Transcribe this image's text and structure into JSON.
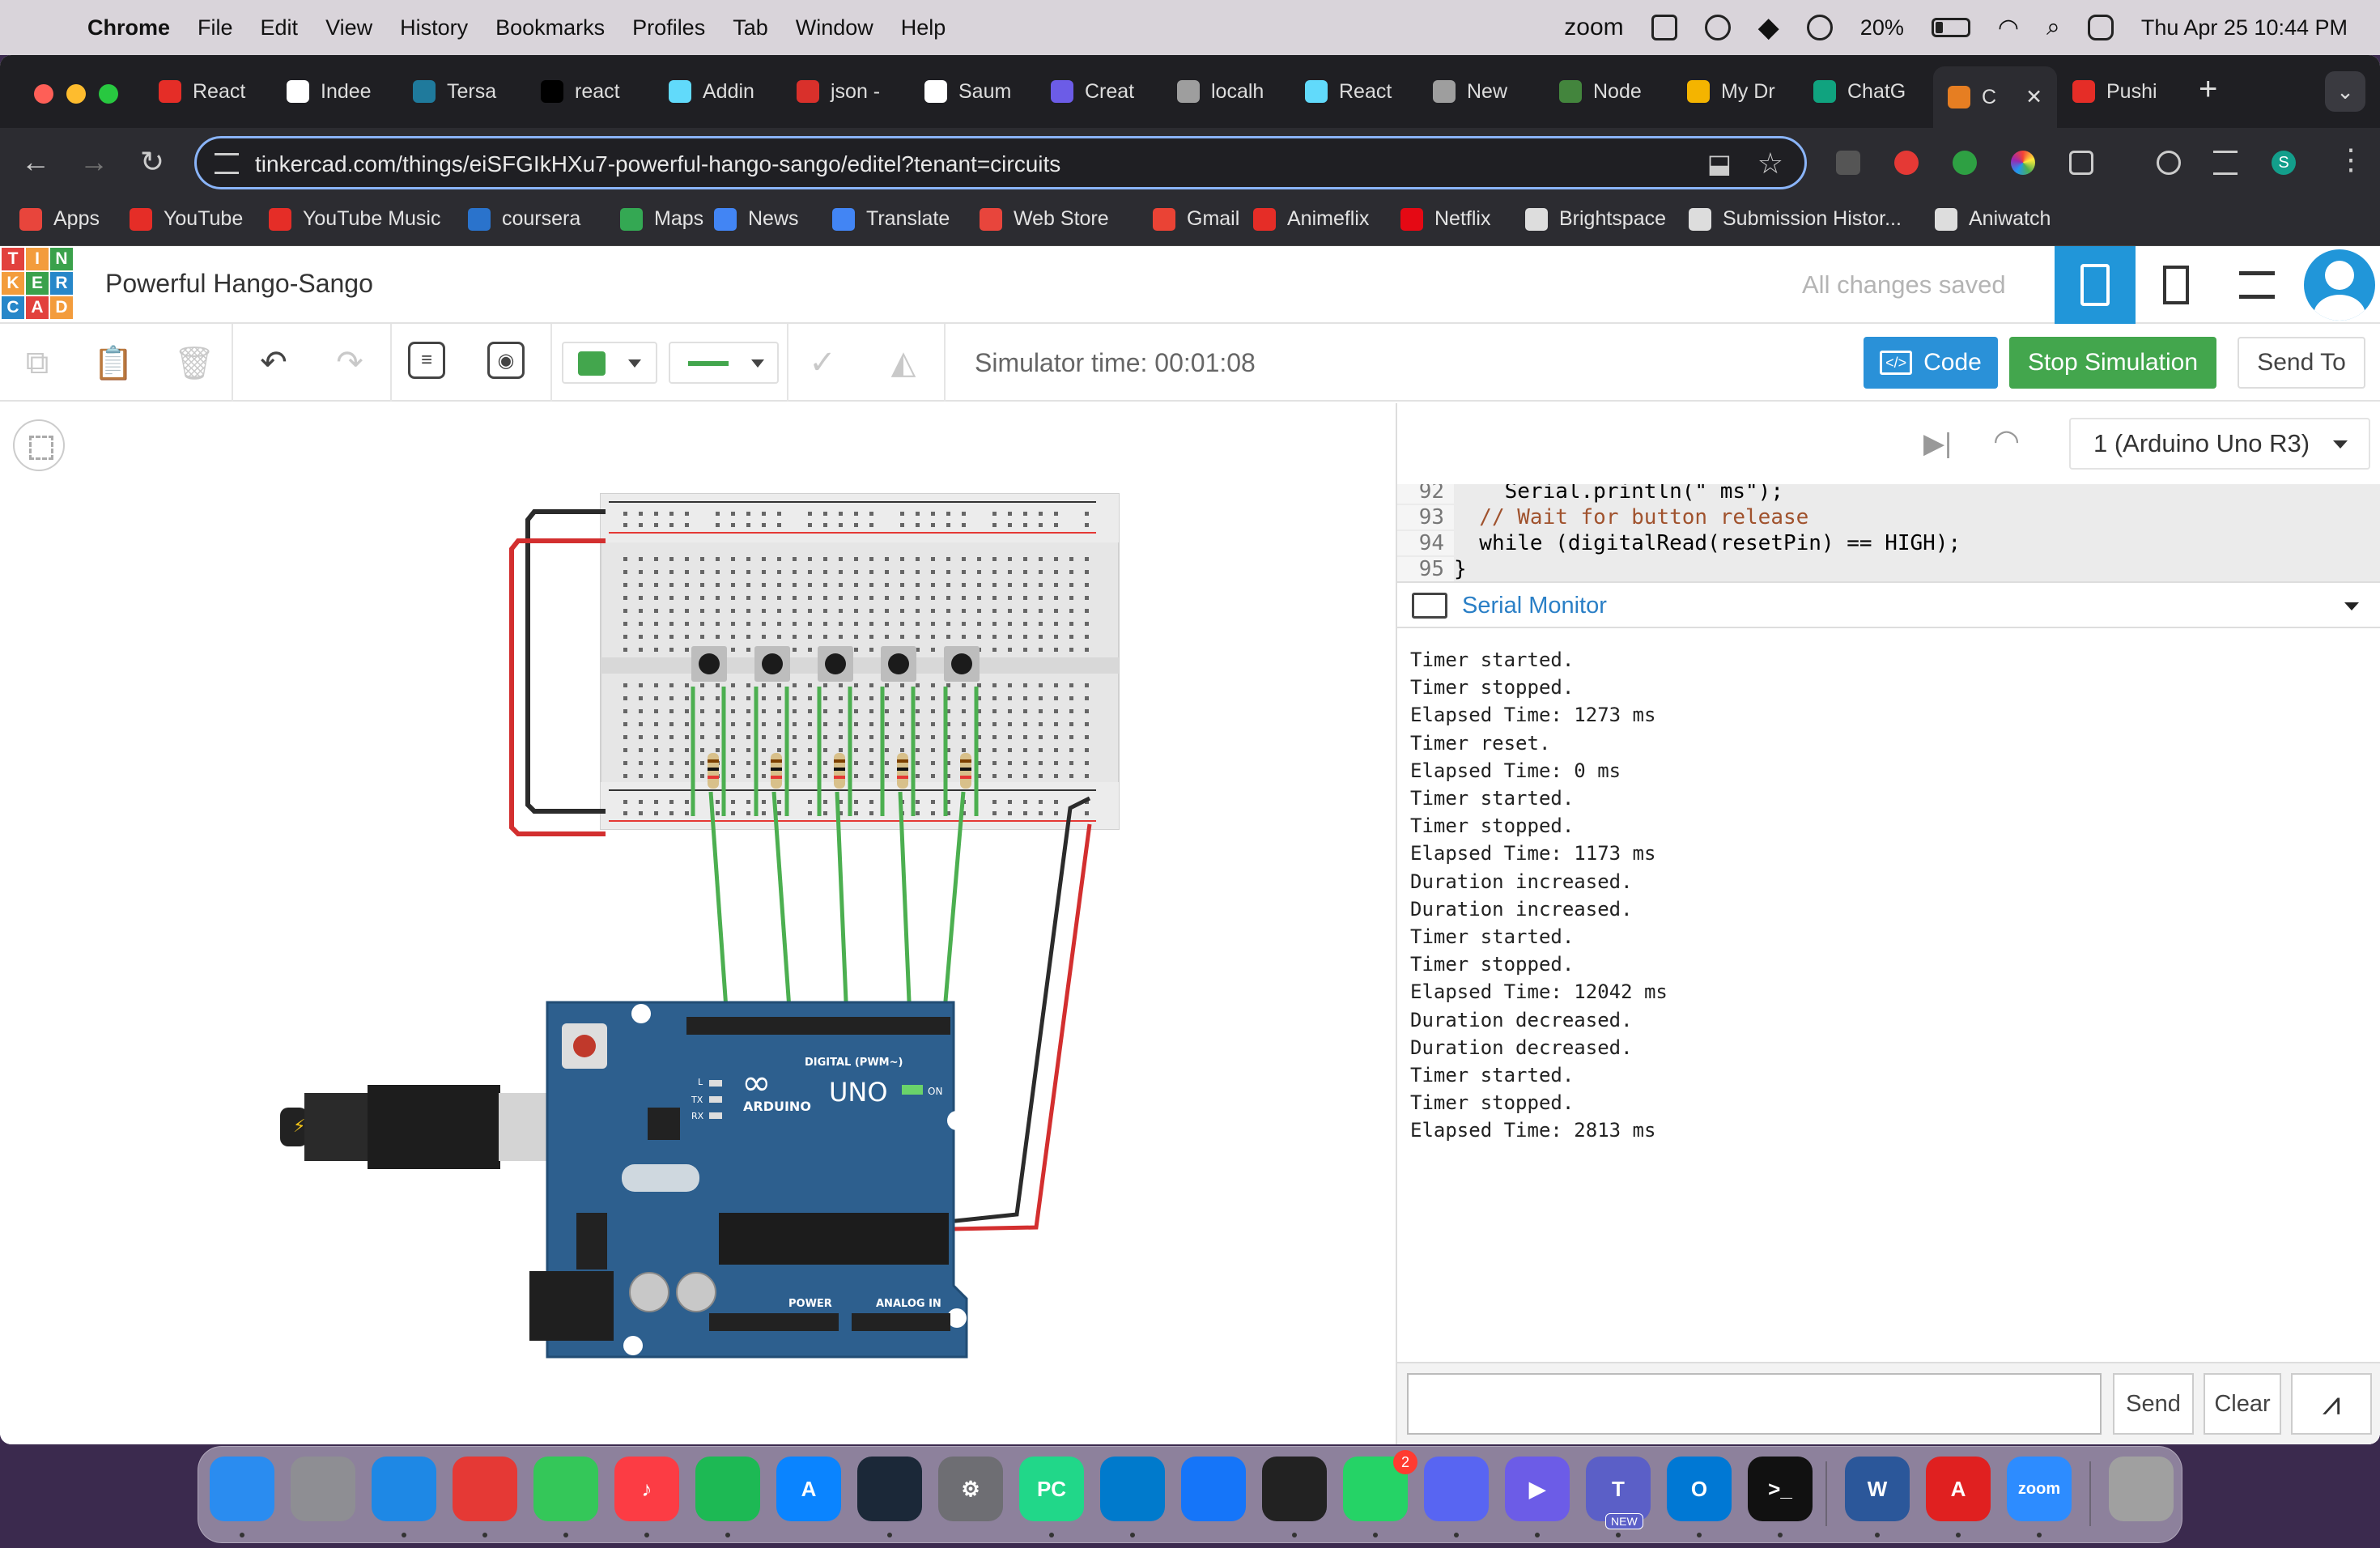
{
  "menubar": {
    "app": "Chrome",
    "items": [
      "File",
      "Edit",
      "View",
      "History",
      "Bookmarks",
      "Profiles",
      "Tab",
      "Window",
      "Help"
    ],
    "zoom_label": "zoom",
    "battery": "20%",
    "clock": "Thu Apr 25  10:44 PM"
  },
  "tabs": [
    {
      "title": "React",
      "color": "#e52d27"
    },
    {
      "title": "Indee",
      "color": "#ffffff"
    },
    {
      "title": "Tersa",
      "color": "#1f7a9c"
    },
    {
      "title": "react",
      "color": "#000000"
    },
    {
      "title": "Addin",
      "color": "#61dafb"
    },
    {
      "title": "json -",
      "color": "#d9302b"
    },
    {
      "title": "Saum",
      "color": "#ffffff"
    },
    {
      "title": "Creat",
      "color": "#6c5ce7"
    },
    {
      "title": "localh",
      "color": "#9e9e9e"
    },
    {
      "title": "React",
      "color": "#61dafb"
    },
    {
      "title": "New",
      "color": "#9e9e9e"
    },
    {
      "title": "Node",
      "color": "#43853d"
    },
    {
      "title": "My Dr",
      "color": "#f4b400"
    },
    {
      "title": "ChatG",
      "color": "#10a37f"
    },
    {
      "title": "C",
      "color": "#e67e22"
    },
    {
      "title": "Pushi",
      "color": "#e52d27"
    }
  ],
  "address": {
    "url": "tinkercad.com/things/eiSFGIkHXu7-powerful-hango-sango/editel?tenant=circuits"
  },
  "bookmarks": [
    {
      "label": "Apps",
      "color": "#e8453c"
    },
    {
      "label": "YouTube",
      "color": "#e52d27"
    },
    {
      "label": "YouTube Music",
      "color": "#e52d27"
    },
    {
      "label": "coursera",
      "color": "#2a73cc"
    },
    {
      "label": "Maps",
      "color": "#34a853"
    },
    {
      "label": "News",
      "color": "#4285f4"
    },
    {
      "label": "Translate",
      "color": "#4285f4"
    },
    {
      "label": "Web Store",
      "color": "#e8453c"
    },
    {
      "label": "Gmail",
      "color": "#ea4335"
    },
    {
      "label": "Animeflix",
      "color": "#e52d27"
    },
    {
      "label": "Netflix",
      "color": "#e50914"
    },
    {
      "label": "Brightspace",
      "color": "#dddddd"
    },
    {
      "label": "Submission Histor...",
      "color": "#dddddd"
    },
    {
      "label": "Aniwatch",
      "color": "#dddddd"
    }
  ],
  "tinkercad": {
    "logo": [
      "T",
      "I",
      "N",
      "K",
      "E",
      "R",
      "C",
      "A",
      "D"
    ],
    "project_title": "Powerful Hango-Sango",
    "save_status": "All changes saved",
    "simulator_time": "Simulator time: 00:01:08",
    "code_label": "Code",
    "stop_label": "Stop Simulation",
    "send_to_label": "Send To",
    "device": "1 (Arduino Uno R3)",
    "code_lines": [
      {
        "num": "92",
        "code": "    Serial.println(\" ms\");"
      },
      {
        "num": "93",
        "code": "  // Wait for button release"
      },
      {
        "num": "94",
        "code": "  while (digitalRead(resetPin) == HIGH);"
      },
      {
        "num": "95",
        "code": "}"
      }
    ],
    "serial_title": "Serial Monitor",
    "serial_output": [
      "Timer started.",
      "Timer stopped.",
      "Elapsed Time: 1273 ms",
      "Timer reset.",
      "Elapsed Time: 0 ms",
      "Timer started.",
      "Timer stopped.",
      "Elapsed Time: 1173 ms",
      "Duration increased.",
      "Duration increased.",
      "Timer started.",
      "Timer stopped.",
      "Elapsed Time: 12042 ms",
      "Duration decreased.",
      "Duration decreased.",
      "Timer started.",
      "Timer stopped.",
      "Elapsed Time: 2813 ms"
    ],
    "serial_input": "",
    "send_label": "Send",
    "clear_label": "Clear"
  },
  "board": {
    "brand": "ARDUINO",
    "model": "UNO",
    "digital_label": "DIGITAL (PWM~)",
    "power_label": "POWER",
    "analog_label": "ANALOG IN",
    "on_label": "ON",
    "tx_label": "TX",
    "rx_label": "RX",
    "l_label": "L"
  },
  "dock": {
    "whatsapp_badge": "2",
    "teams_badge": "NEW"
  }
}
